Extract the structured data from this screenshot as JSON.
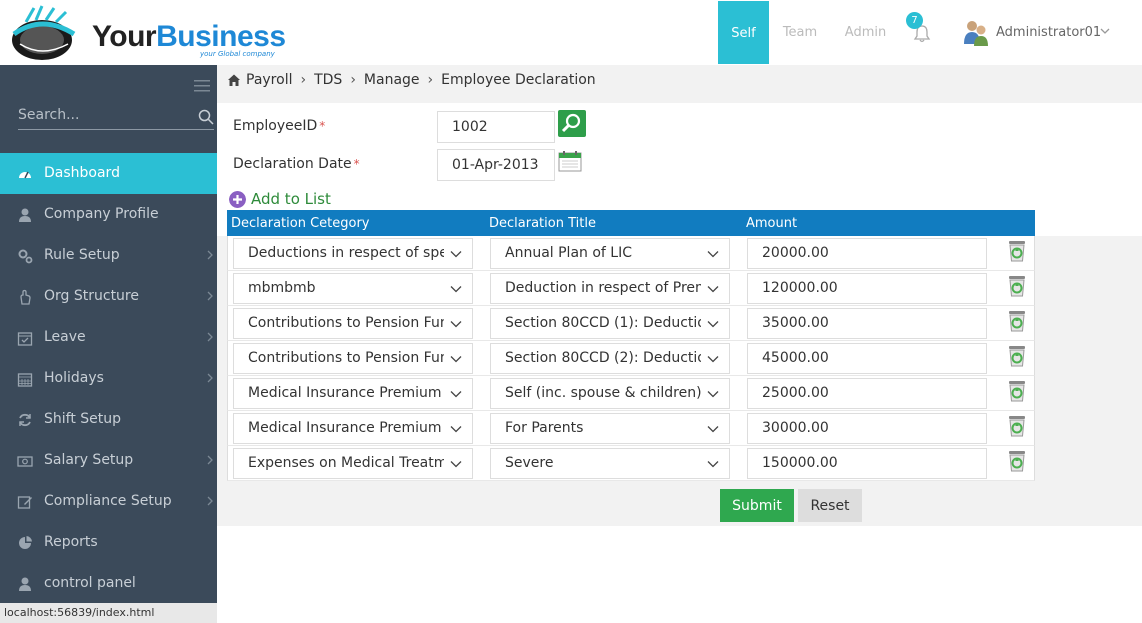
{
  "header": {
    "brand_your": "Your",
    "brand_business": "Business",
    "tagline": "your Global company",
    "nav": [
      "Self",
      "Team",
      "Admin"
    ],
    "notifications_count": "7",
    "user_name": "Administrator01"
  },
  "sidebar": {
    "search_placeholder": "Search...",
    "items": [
      {
        "label": "Dashboard",
        "icon": "dashboard-icon",
        "active": true
      },
      {
        "label": "Company Profile",
        "icon": "user-icon"
      },
      {
        "label": "Rule Setup",
        "icon": "cogs-icon"
      },
      {
        "label": "Org Structure",
        "icon": "hand-icon"
      },
      {
        "label": "Leave",
        "icon": "calendar-check-icon"
      },
      {
        "label": "Holidays",
        "icon": "calendar-icon"
      },
      {
        "label": "Shift Setup",
        "icon": "refresh-icon"
      },
      {
        "label": "Salary Setup",
        "icon": "money-icon"
      },
      {
        "label": "Compliance Setup",
        "icon": "edit-icon"
      },
      {
        "label": "Reports",
        "icon": "pie-chart-icon"
      },
      {
        "label": "control panel",
        "icon": "user-icon"
      }
    ]
  },
  "status_url": "localhost:56839/index.html",
  "breadcrumb": [
    "Payroll",
    "TDS",
    "Manage",
    "Employee Declaration"
  ],
  "form": {
    "employee_id_label": "EmployeeID",
    "employee_id_value": "1002",
    "declaration_date_label": "Declaration Date",
    "declaration_date_value": "01-Apr-2013",
    "required_mark": "*",
    "add_to_list": "Add to List"
  },
  "table": {
    "headers": [
      "Declaration Cetegory",
      "Declaration Title",
      "Amount"
    ],
    "rows": [
      {
        "category": "Deductions in respect of spec",
        "title": "Annual Plan of LIC",
        "amount": "20000.00"
      },
      {
        "category": "mbmbmb",
        "title": "Deduction in respect of Prem",
        "amount": "120000.00"
      },
      {
        "category": "Contributions to Pension Fun",
        "title": "Section 80CCD (1): Deduction",
        "amount": "35000.00"
      },
      {
        "category": "Contributions to Pension Fun",
        "title": "Section 80CCD (2): Deduction",
        "amount": "45000.00"
      },
      {
        "category": "Medical Insurance Premium F",
        "title": "Self (inc. spouse & children)",
        "amount": "25000.00"
      },
      {
        "category": "Medical Insurance Premium F",
        "title": "For Parents",
        "amount": "30000.00"
      },
      {
        "category": "Expenses on Medical Treatme",
        "title": "Severe",
        "amount": "150000.00"
      }
    ]
  },
  "buttons": {
    "submit": "Submit",
    "reset": "Reset"
  },
  "colors": {
    "accent": "#2bbfd4",
    "sidebar": "#3b4a5a",
    "table_header": "#117cc0",
    "submit": "#2fa84f"
  }
}
